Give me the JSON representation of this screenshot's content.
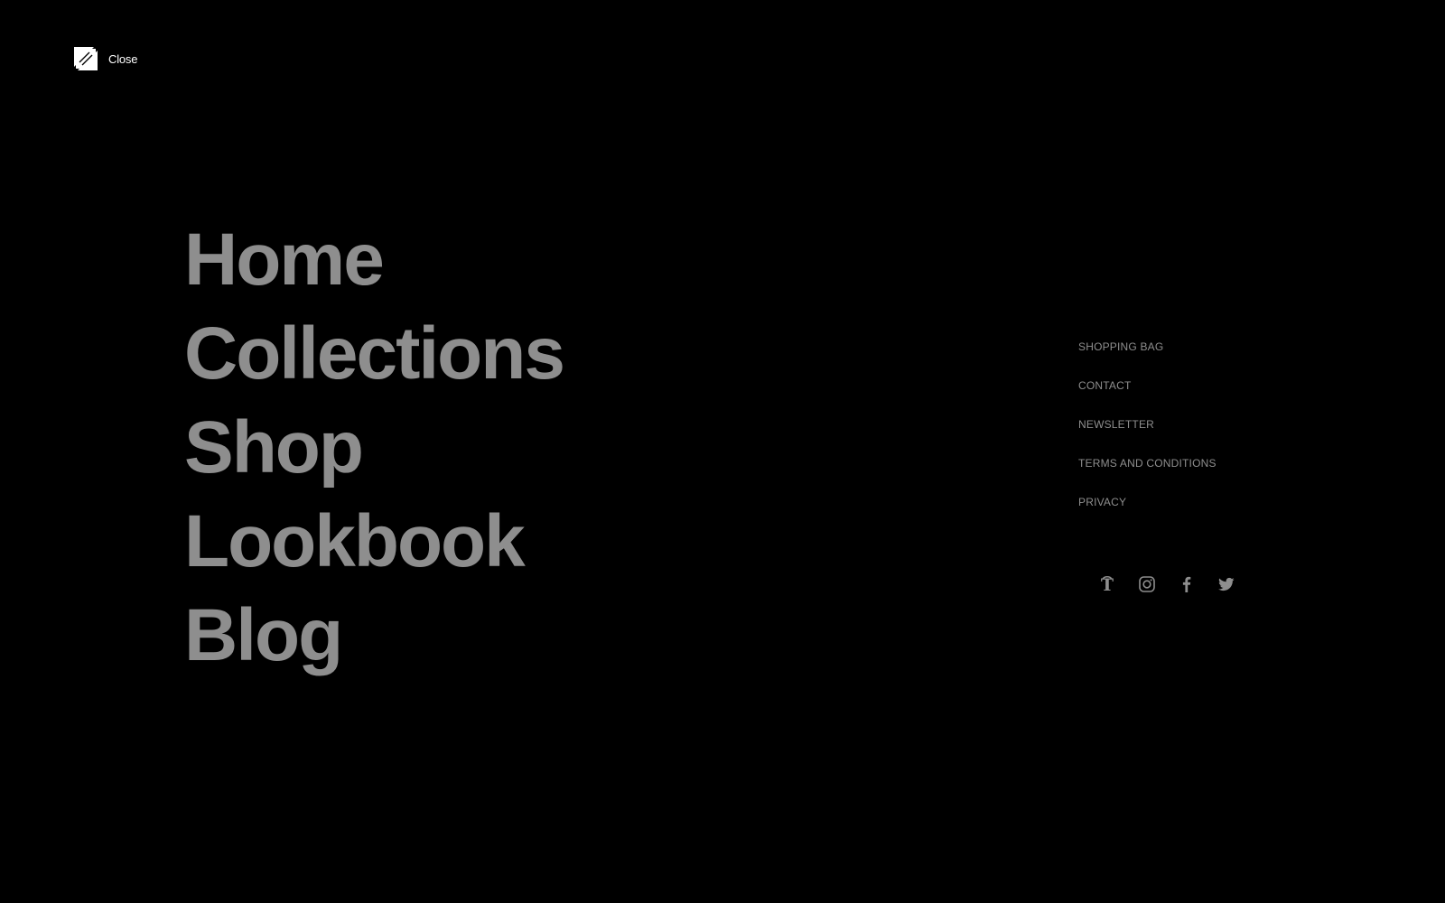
{
  "close": {
    "label": "Close",
    "icon": "expand-arrows-icon"
  },
  "primary_nav": {
    "items": [
      {
        "label": "Home"
      },
      {
        "label": "Collections"
      },
      {
        "label": "Shop"
      },
      {
        "label": "Lookbook"
      },
      {
        "label": "Blog"
      }
    ]
  },
  "secondary_nav": {
    "items": [
      {
        "label": "SHOPPING BAG"
      },
      {
        "label": "CONTACT"
      },
      {
        "label": "NEWSLETTER"
      },
      {
        "label": "TERMS AND CONDITIONS"
      },
      {
        "label": "PRIVACY"
      }
    ]
  },
  "social": {
    "icons": [
      "ny-times-icon",
      "instagram-icon",
      "facebook-icon",
      "twitter-icon"
    ]
  },
  "colors": {
    "background": "#000000",
    "nav_text": "#8e8e8e",
    "close_text": "#ffffff"
  }
}
